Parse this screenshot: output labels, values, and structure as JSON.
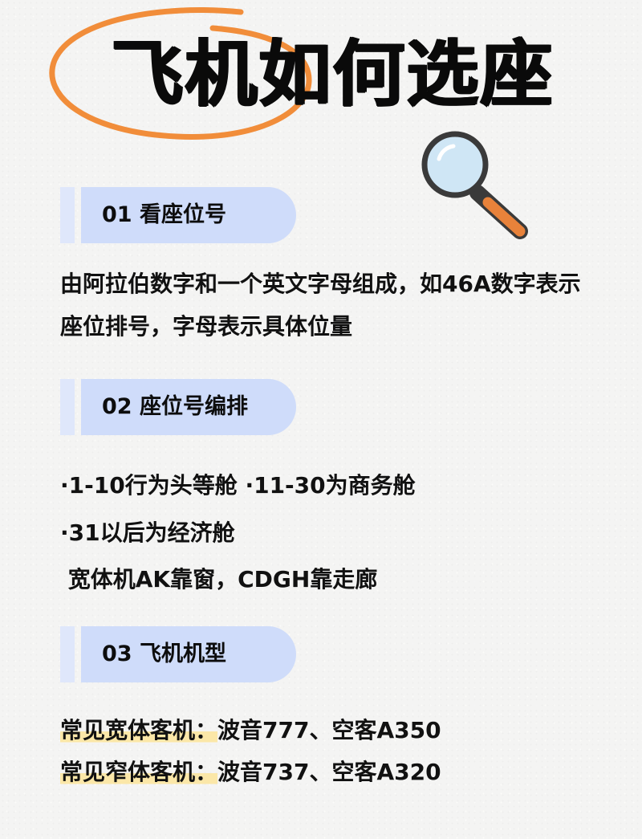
{
  "title": "飞机如何选座",
  "colors": {
    "circle": "#f18d3a",
    "section_pill": "#cfdcfa",
    "section_bar": "#dfe7fb",
    "highlight": "#fbe7a8",
    "magnifier_lens": "#cfe6f5",
    "magnifier_handle": "#e8823a"
  },
  "decor": {
    "title_marker": "orange-hand-drawn-circle",
    "icon": "magnifier-icon"
  },
  "sections": [
    {
      "heading": "01 看座位号",
      "lines": [
        "由阿拉伯数字和一个英文字母组成，如46A数字表示",
        "座位排号，字母表示具体位量"
      ]
    },
    {
      "heading": "02 座位号编排",
      "lines": [
        "·1-10行为头等舱 ·11-30为商务舱",
        "·31以后为经济舱",
        " 宽体机AK靠窗，CDGH靠走廊"
      ]
    },
    {
      "heading": "03 飞机机型",
      "rows": [
        {
          "label": "常见宽体客机：",
          "value": "波音777、空客A350"
        },
        {
          "label": "常见窄体客机：",
          "value": "波音737、空客A320"
        }
      ]
    }
  ]
}
